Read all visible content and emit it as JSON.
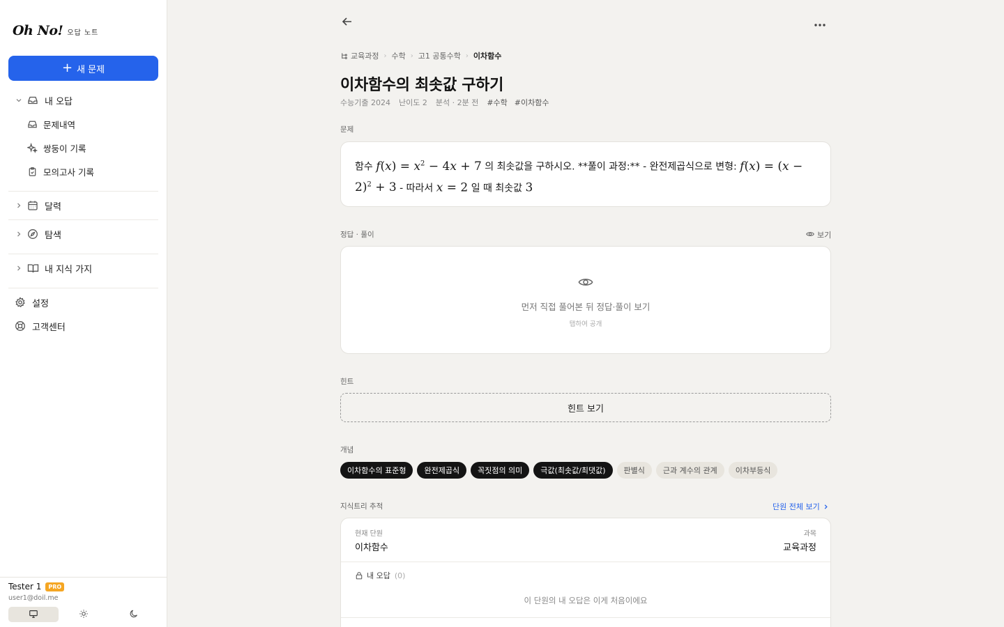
{
  "brand": {
    "logo": "Oh No!",
    "subtitle": "오답 노트"
  },
  "sidebar": {
    "new_button": "새 문제",
    "my_wrong": "내 오답",
    "sub_items": [
      "문제내역",
      "쌍둥이 기록",
      "모의고사 기록"
    ],
    "calendar": "달력",
    "explore": "탐색",
    "knowledge": "내 지식 가지",
    "settings": "설정",
    "support": "고객센터"
  },
  "user": {
    "name": "Tester 1",
    "badge": "PRO",
    "email": "user1@doil.me",
    "theme_selected": "system"
  },
  "breadcrumb": [
    "교육과정",
    "수학",
    "고1 공통수학",
    "이차함수"
  ],
  "title": "이차함수의 최솟값 구하기",
  "meta": {
    "source": "수능기출 2024",
    "difficulty": "난이도 2",
    "analyzed": "분석 · 2분 전",
    "tags": [
      "#수학",
      "#이차함수"
    ]
  },
  "problem": {
    "label": "문제",
    "p1": "함수 ",
    "p2": " 의 최솟값을 구하시오. **풀이 과정:** - 완전제곱식으로 변형: ",
    "p3": " - 따라서 ",
    "p4": " 일 때 최솟값 "
  },
  "answer": {
    "label": "정답 · 풀이",
    "reveal": "보기",
    "message": "먼저 직접 풀어본 뒤 정답·풀이 보기",
    "sub": "탭하여 공개"
  },
  "hint": {
    "label": "힌트",
    "button": "힌트 보기"
  },
  "concepts": {
    "label": "개념",
    "items": [
      {
        "text": "이차함수의 표준형",
        "active": true
      },
      {
        "text": "완전제곱식",
        "active": true
      },
      {
        "text": "꼭짓점의 의미",
        "active": true
      },
      {
        "text": "극값(최솟값/최댓값)",
        "active": true
      },
      {
        "text": "판별식",
        "active": false
      },
      {
        "text": "근과 계수의 관계",
        "active": false
      },
      {
        "text": "이차부등식",
        "active": false
      }
    ]
  },
  "tree": {
    "label": "지식트리 추적",
    "link": "단원 전체 보기",
    "current_label": "현재 단원",
    "current_value": "이차함수",
    "subject_label": "과목",
    "subject_value": "교육과정",
    "my_wrong": "내 오답",
    "count": "(0)",
    "empty": "이 단원의 내 오답은 이게 처음이에요"
  }
}
